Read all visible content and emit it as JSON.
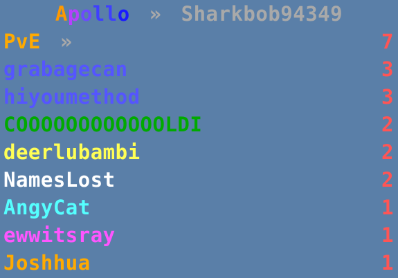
{
  "header": {
    "title_letters": [
      {
        "ch": "A",
        "color": "#ff9900"
      },
      {
        "ch": "p",
        "color": "#b640ff"
      },
      {
        "ch": "o",
        "color": "#6b4bff"
      },
      {
        "ch": "l",
        "color": "#3f3fff"
      },
      {
        "ch": "l",
        "color": "#3f3fff"
      },
      {
        "ch": "o",
        "color": "#1a1aff"
      }
    ],
    "separator": "»",
    "separator_color": "#a9a9a9",
    "player": "Sharkbob94349",
    "player_color": "#a9a9a9"
  },
  "section": {
    "label": "PvE",
    "label_color": "#ffaa00",
    "separator": "»",
    "separator_color": "#a9a9a9",
    "score": "7",
    "score_color": "#ff5555"
  },
  "rows": [
    {
      "name": "grabagecan",
      "name_color": "#5555ff",
      "score": "3",
      "score_color": "#ff5555"
    },
    {
      "name": "hiyoumethod",
      "name_color": "#5555ff",
      "score": "3",
      "score_color": "#ff5555"
    },
    {
      "name": "COOOOOOOOOOOOLDI",
      "name_color": "#00aa00",
      "score": "2",
      "score_color": "#ff5555"
    },
    {
      "name": "deerlubambi",
      "name_color": "#ffff55",
      "score": "2",
      "score_color": "#ff5555"
    },
    {
      "name": "NamesLost",
      "name_color": "#ffffff",
      "score": "2",
      "score_color": "#ff5555"
    },
    {
      "name": "AngyCat",
      "name_color": "#55ffff",
      "score": "1",
      "score_color": "#ff5555"
    },
    {
      "name": "ewwitsray",
      "name_color": "#ff55ff",
      "score": "1",
      "score_color": "#ff5555"
    },
    {
      "name": "Joshhua",
      "name_color": "#ffaa00",
      "score": "1",
      "score_color": "#ff5555"
    }
  ],
  "background_color": "#5a7fa8"
}
